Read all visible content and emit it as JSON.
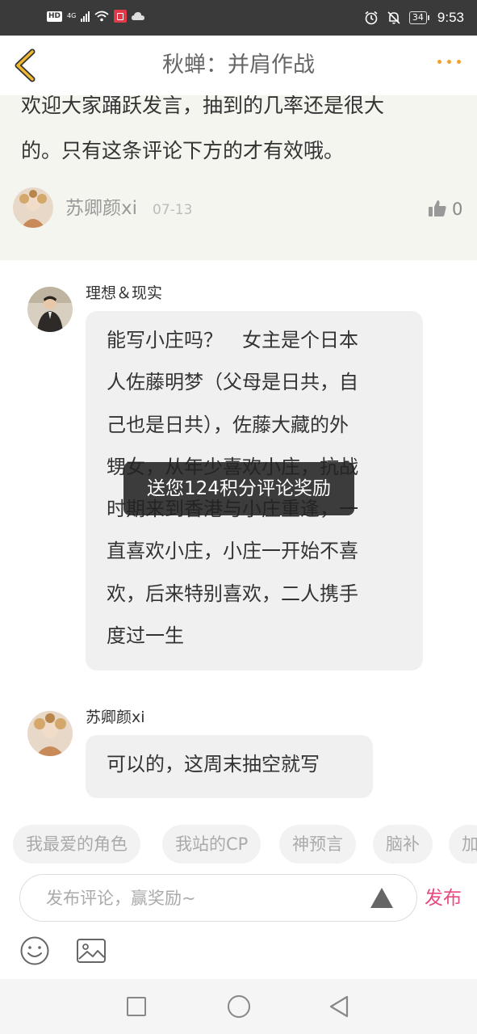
{
  "status_bar": {
    "hd_label": "HD",
    "network_label": "4G",
    "battery": "34",
    "time": "9:53"
  },
  "header": {
    "title": "秋蝉：并肩作战"
  },
  "parent_comment": {
    "line1": "欢迎大家踊跃发言，抽到的几率还是很大",
    "line2": "的。只有这条评论下方的才有效哦。",
    "author": "苏卿颜xi",
    "date": "07-13",
    "likes": "0"
  },
  "replies": [
    {
      "author": "理想＆现实",
      "lines": [
        "能写小庄吗？　女主是个日本",
        "人佐藤明梦（父母是日共，自",
        "己也是日共），佐藤大藏的外",
        "甥女，从年少喜欢小庄，抗战",
        "时期来到香港与小庄重逢，一",
        "直喜欢小庄，小庄一开始不喜",
        "欢，后来特别喜欢，二人携手",
        "度过一生"
      ]
    },
    {
      "author": "苏卿颜xi",
      "lines": [
        "可以的，这周末抽空就写"
      ]
    }
  ],
  "toast": "送您124积分评论奖励",
  "tags": [
    "我最爱的角色",
    "我站的CP",
    "神预言",
    "脑补",
    "加"
  ],
  "composer": {
    "placeholder": "发布评论，赢奖励~",
    "publish_label": "发布"
  },
  "colors": {
    "accent_yellow": "#f0a030",
    "publish_pink": "#e84a7f",
    "parent_bg": "#f5f5f0",
    "bubble_bg": "#f0f0f0"
  }
}
